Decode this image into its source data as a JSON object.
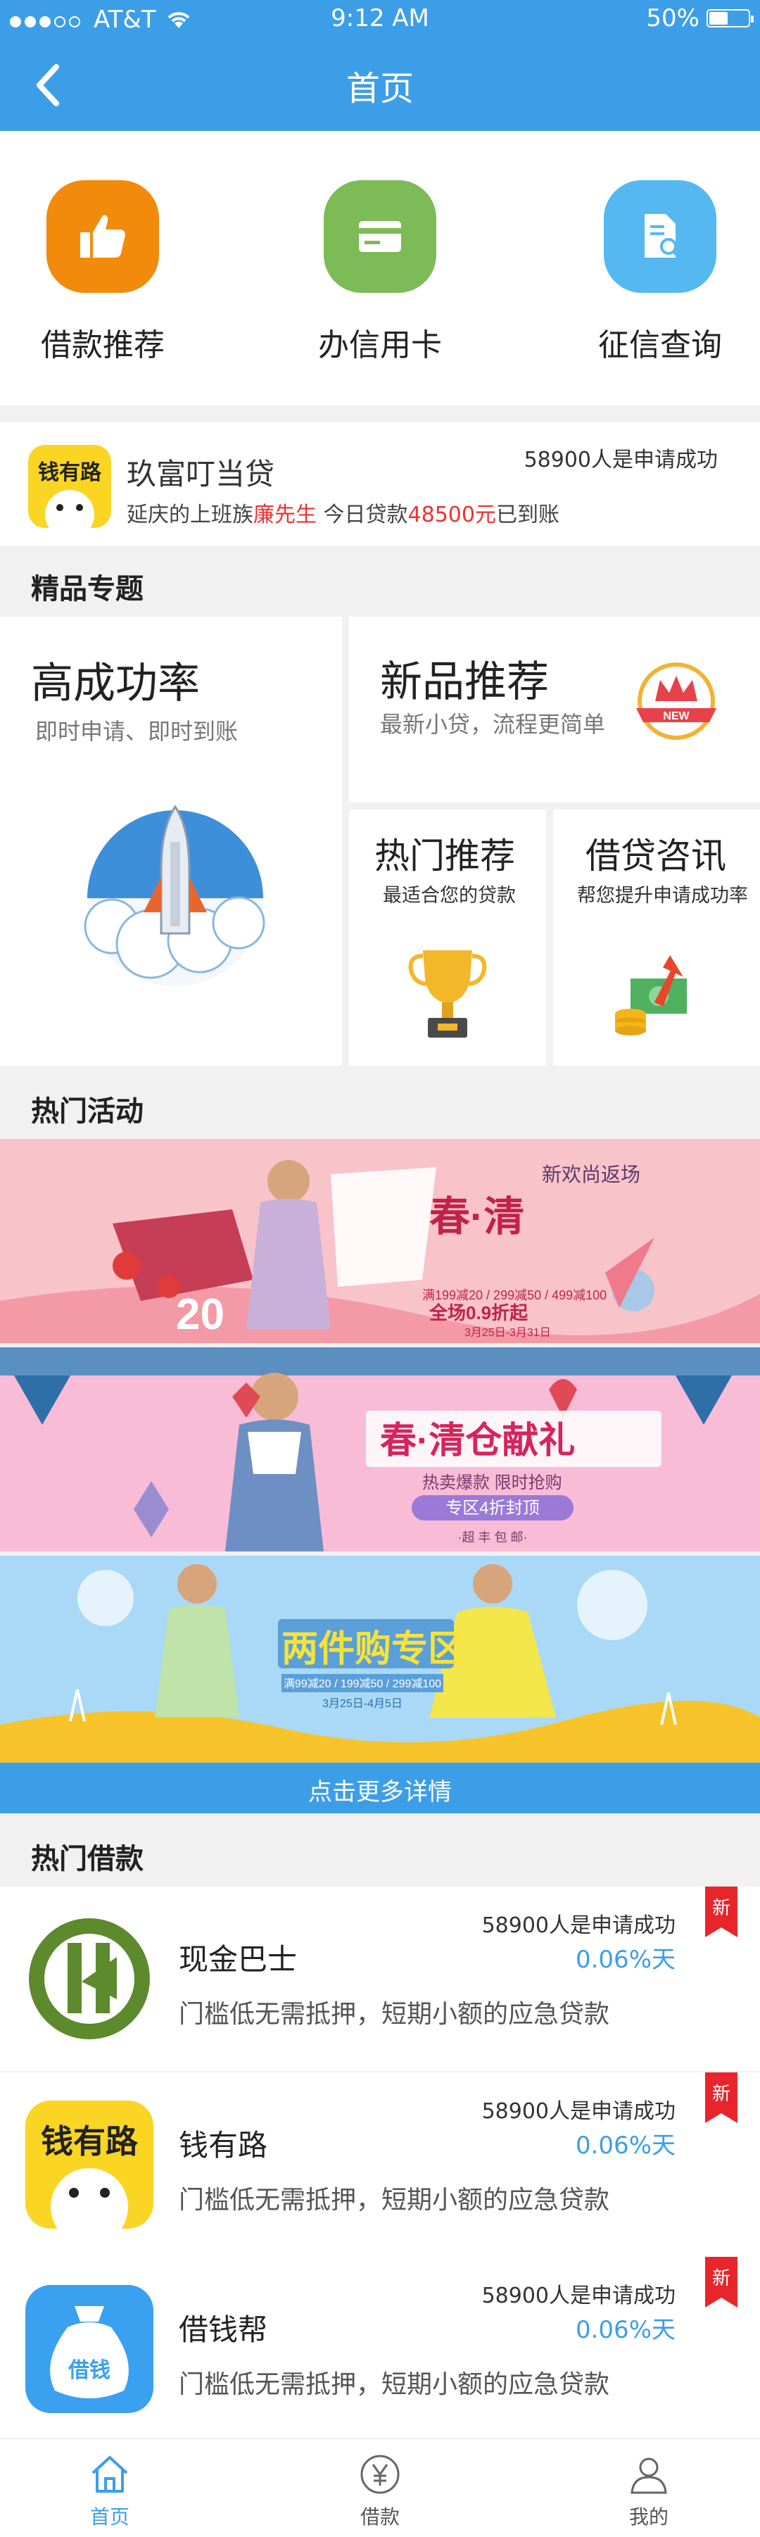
{
  "status": {
    "carrier": "AT&T",
    "time": "9:12 AM",
    "battery": "50%"
  },
  "nav": {
    "title": "首页"
  },
  "quick": [
    {
      "label": "借款推荐",
      "icon": "thumbs-up-icon",
      "color": "#f28a0b"
    },
    {
      "label": "办信用卡",
      "icon": "credit-card-icon",
      "color": "#7dbb56"
    },
    {
      "label": "征信查询",
      "icon": "document-search-icon",
      "color": "#55b8f1"
    }
  ],
  "notice": {
    "logo_text": "钱有路",
    "name": "玖富叮当贷",
    "count": "58900人是申请成功",
    "desc_prefix": "延庆的上班族",
    "desc_person": "廉先生",
    "desc_mid": "  今日贷款",
    "desc_amount": "48500元",
    "desc_suffix": "已到账"
  },
  "sections": {
    "featured": "精品专题",
    "activity": "热门活动",
    "loans": "热门借款"
  },
  "featured": {
    "high": {
      "title": "高成功率",
      "sub": "即时申请、即时到账"
    },
    "new": {
      "title": "新品推荐",
      "sub": "最新小贷，流程更简单",
      "badge": "NEW"
    },
    "hot": {
      "title": "热门推荐",
      "sub": "最适合您的贷款"
    },
    "news": {
      "title": "借贷咨讯",
      "sub": "帮您提升申请成功率"
    }
  },
  "banners": [
    {
      "headline": "春·清",
      "tag": "新欢尚返场",
      "price": "20",
      "line1": "满199减20 / 299减50 / 499减100",
      "line2": "全场0.9折起",
      "line3": "3月25日-3月31日"
    },
    {
      "headline": "春·清仓献礼",
      "line1": "热卖爆款 限时抢购",
      "line2": "专区4折封顶",
      "line3": "·超 丰 包 邮·"
    },
    {
      "headline": "两件购专区",
      "line1": "满99减20 / 199减50 / 299减100",
      "line2": "3月25日-4月5日"
    }
  ],
  "more": "点击更多详情",
  "loans": [
    {
      "name": "现金巴士",
      "count": "58900人是申请成功",
      "rate": "0.06%天",
      "desc": "门槛低无需抵押，短期小额的应急贷款",
      "badge": "新",
      "logo": "cash-bus-logo"
    },
    {
      "name": "钱有路",
      "count": "58900人是申请成功",
      "rate": "0.06%天",
      "desc": "门槛低无需抵押，短期小额的应急贷款",
      "badge": "新",
      "logo_text": "钱有路",
      "logo": "qianyoulu-logo"
    },
    {
      "name": "借钱帮",
      "count": "58900人是申请成功",
      "rate": "0.06%天",
      "desc": "门槛低无需抵押，短期小额的应急贷款",
      "badge": "新",
      "logo_text": "借钱",
      "logo": "jieqianbang-logo"
    }
  ],
  "tabs": [
    {
      "label": "首页",
      "icon": "home-icon",
      "active": true
    },
    {
      "label": "借款",
      "icon": "yuan-icon",
      "active": false
    },
    {
      "label": "我的",
      "icon": "user-icon",
      "active": false
    }
  ],
  "colors": {
    "primary": "#3d9ee8",
    "red": "#f23030"
  }
}
